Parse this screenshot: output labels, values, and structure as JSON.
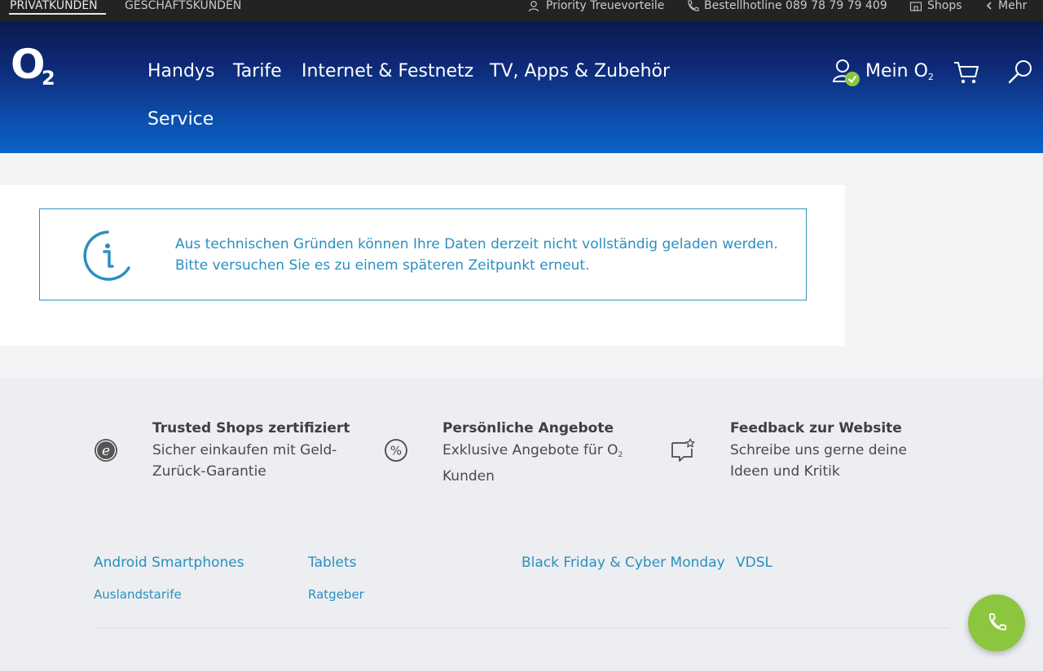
{
  "topbar": {
    "segments": [
      "PRIVATKUNDEN",
      "GESCHÄFTSKUNDEN"
    ],
    "priority": "Priority Treuevorteile",
    "hotline": "Bestellhotline 089 78 79 79 409",
    "shops": "Shops",
    "mehr": "Mehr"
  },
  "header": {
    "logo_o": "O",
    "logo_2": "2",
    "nav": [
      "Handys",
      "Tarife",
      "Internet & Festnetz",
      "TV, Apps & Zubehör",
      "Service"
    ],
    "mein_label": "Mein O",
    "mein_sub": "2"
  },
  "notice": {
    "line1": "Aus technischen Gründen können Ihre Daten derzeit nicht vollständig geladen werden.",
    "line2": "Bitte versuchen Sie es zu einem späteren Zeitpunkt erneut."
  },
  "features": [
    {
      "icon": "trusted-shops-icon",
      "title": "Trusted Shops zertifiziert",
      "line1": "Sicher einkaufen mit Geld-",
      "line2": "Zurück-Garantie"
    },
    {
      "icon": "percent-icon",
      "title": "Persönliche Angebote",
      "line1": "Exklusive Angebote für O",
      "line1_sub": "2",
      "line2": "Kunden"
    },
    {
      "icon": "feedback-icon",
      "title": "Feedback zur Website",
      "line1": "Schreibe uns gerne deine",
      "line2": "Ideen und Kritik"
    }
  ],
  "footer_links": {
    "primary": [
      "Android Smartphones",
      "Tablets",
      "Black Friday & Cyber Monday",
      "VDSL"
    ],
    "secondary": [
      "Auslandstarife",
      "Ratgeber"
    ]
  },
  "colors": {
    "accent": "#2a8fbf",
    "fab": "#8cc63f",
    "check": "#8cc63f",
    "header_top": "#0b1a4f",
    "header_bottom": "#0a63c9"
  }
}
